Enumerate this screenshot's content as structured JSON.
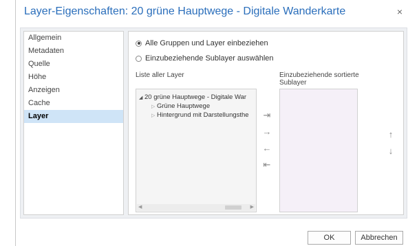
{
  "dialog": {
    "title": "Layer-Eigenschaften: 20 grüne Hauptwege - Digitale Wanderkarte",
    "close_glyph": "×"
  },
  "nav": {
    "items": [
      {
        "label": "Allgemein",
        "selected": false
      },
      {
        "label": "Metadaten",
        "selected": false
      },
      {
        "label": "Quelle",
        "selected": false
      },
      {
        "label": "Höhe",
        "selected": false
      },
      {
        "label": "Anzeigen",
        "selected": false
      },
      {
        "label": "Cache",
        "selected": false
      },
      {
        "label": "Layer",
        "selected": true
      }
    ]
  },
  "options": {
    "include_all": "Alle Gruppen und Layer einbeziehen",
    "select_sublayers": "Einzubeziehende Sublayer auswählen",
    "selected_option": "include_all"
  },
  "layer_list": {
    "label": "Liste aller Layer",
    "items": [
      {
        "label": "20 grüne Hauptwege - Digitale War",
        "expanded": true,
        "level": 0
      },
      {
        "label": "Grüne Hauptwege",
        "expanded": false,
        "level": 1
      },
      {
        "label": "Hintergrund mit Darstellungsthe",
        "expanded": false,
        "level": 1
      }
    ]
  },
  "sorted_list": {
    "label_line1": "Einzubeziehende sortierte",
    "label_line2": "Sublayer",
    "items": []
  },
  "transfer_buttons": {
    "add_all_icon": "⇥",
    "add_icon": "→",
    "remove_icon": "←",
    "remove_all_icon": "⇤",
    "move_up_icon": "↑",
    "move_down_icon": "↓"
  },
  "footer": {
    "ok_label": "OK",
    "cancel_label": "Abbrechen"
  },
  "colors": {
    "title": "#2a6ebb",
    "selected_nav_bg": "#cfe4f7",
    "panel_bg": "#eef0f3"
  }
}
